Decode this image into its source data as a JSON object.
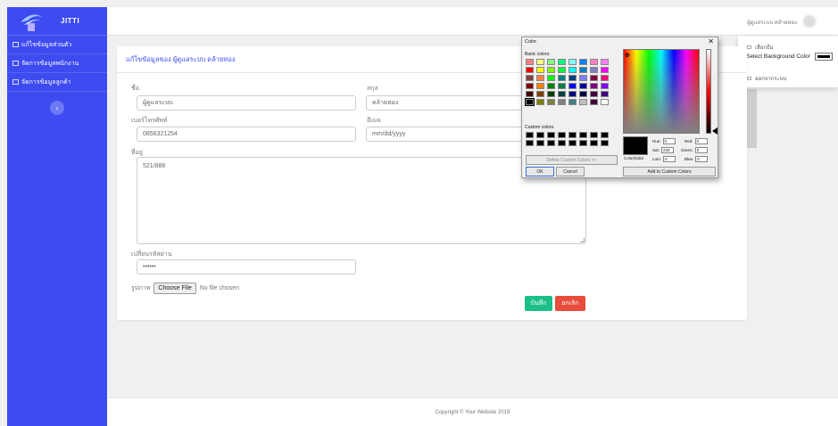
{
  "brand": {
    "name": "JITTI"
  },
  "sidebar": {
    "items": [
      {
        "label": "แก้ไขข้อมูลส่วนตัว"
      },
      {
        "label": "จัดการข้อมูลพนักงาน"
      },
      {
        "label": "จัดการข้อมูลลูกค้า"
      }
    ],
    "toggle_icon": "‹"
  },
  "topbar": {
    "user_name": "ผู้ดูแลระบบ คล้ายทอง"
  },
  "dropdown": {
    "item1": "เลือกธีม",
    "bg_label": "Select Background Color",
    "logout": "ออกจากระบบ",
    "selected_color": "#000000"
  },
  "form": {
    "title": "แก้ไขข้อมูลของ ผู้ดูแลระบบ คล้ายทอง",
    "first_name_label": "ชื่อ",
    "first_name_value": "ผู้ดูแลระบบ",
    "last_name_label": "สกุล",
    "last_name_value": "คล้ายทอง",
    "phone_label": "เบอร์โทรศัพท์",
    "phone_value": "0856321254",
    "email_label": "อีเมล",
    "email_value": "mm/dd/yyyy",
    "address_label": "ที่อยู่",
    "address_value": "521/888",
    "password_label": "เปลี่ยนรหัสผ่าน",
    "password_value": "••••••",
    "photo_label": "รูปภาพ",
    "choose_file": "Choose File",
    "no_file": "No file chosen",
    "save": "บันทึก",
    "cancel": "ยกเลิก"
  },
  "footer": {
    "text": "Copyright © Your Website 2019"
  },
  "color_dialog": {
    "title": "Color",
    "close": "✕",
    "basic_colors_label": "Basic colors:",
    "custom_colors_label": "Custom colors:",
    "define_custom": "Define Custom Colors >>",
    "ok": "OK",
    "cancel": "Cancel",
    "add_custom": "Add to Custom Colors",
    "color_solid": "Color|Solid",
    "hue_label": "Hue:",
    "hue": "0",
    "sat_label": "Sat:",
    "sat": "233",
    "lum_label": "Lum:",
    "lum": "0",
    "red_label": "Red:",
    "red": "0",
    "green_label": "Green:",
    "green": "0",
    "blue_label": "Blue:",
    "blue": "0",
    "basic_colors": [
      "#ff8080",
      "#ffff80",
      "#80ff80",
      "#00ff80",
      "#80ffff",
      "#0080ff",
      "#ff80c0",
      "#ff80ff",
      "#ff0000",
      "#ffff00",
      "#80ff00",
      "#00ff40",
      "#00ffff",
      "#0080c0",
      "#8080c0",
      "#ff00ff",
      "#804040",
      "#ff8040",
      "#00ff00",
      "#008080",
      "#004080",
      "#8080ff",
      "#800040",
      "#ff0080",
      "#800000",
      "#ff8000",
      "#008000",
      "#008040",
      "#0000ff",
      "#0000a0",
      "#800080",
      "#8000ff",
      "#400000",
      "#804000",
      "#004000",
      "#004040",
      "#000080",
      "#000040",
      "#400040",
      "#400080",
      "#000000",
      "#808000",
      "#808040",
      "#808080",
      "#408080",
      "#c0c0c0",
      "#400040",
      "#ffffff"
    ]
  }
}
